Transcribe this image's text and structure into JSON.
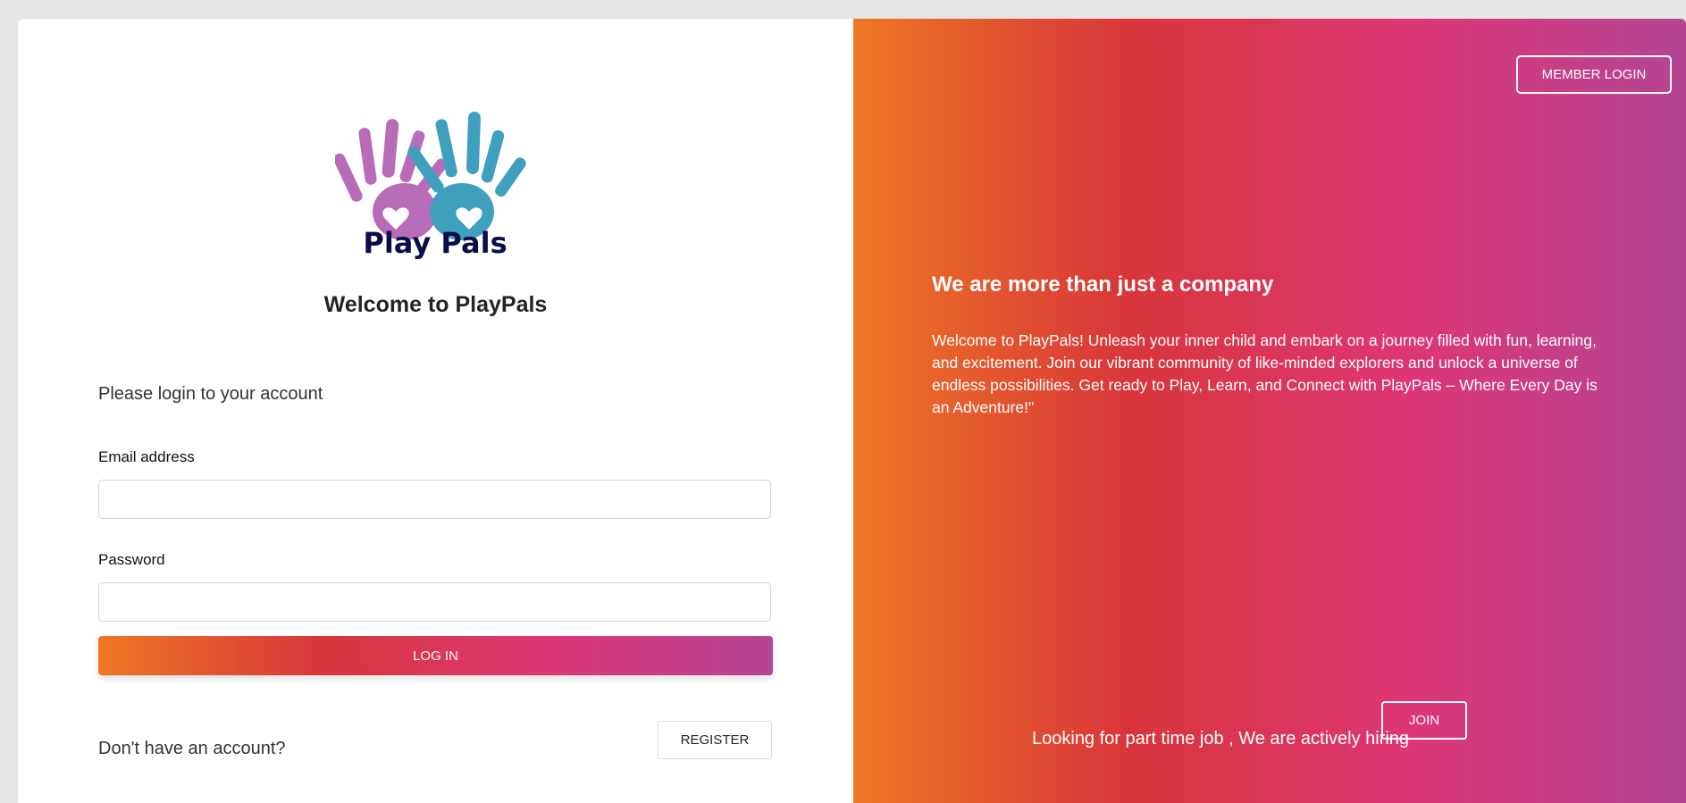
{
  "brand": {
    "logo_text": "Play Pals",
    "logo_colors": [
      "#b86cb8",
      "#3f9fbf",
      "#0b0d4a"
    ]
  },
  "login": {
    "welcome_title": "Welcome to PlayPals",
    "prompt": "Please login to your account",
    "email_label": "Email address",
    "email_value": "",
    "password_label": "Password",
    "password_value": "",
    "login_button": "LOG IN",
    "no_account_text": "Don't have an account?",
    "register_button": "REGISTER"
  },
  "hero": {
    "member_login_button": "MEMBER LOGIN",
    "title": "We are more than just a company",
    "text": "Welcome to PlayPals! Unleash your inner child and embark on a journey filled with fun, learning, and excitement. Join our vibrant community of like-minded explorers and unlock a universe of endless possibilities. Get ready to Play, Learn, and Connect with PlayPals – Where Every Day is an Adventure!\"",
    "hiring_text": "Looking for part time job , We are actively hiring",
    "join_button": "JOIN"
  },
  "colors": {
    "gradient": [
      "#ee7724",
      "#d8363a",
      "#dd3675",
      "#b44593"
    ],
    "page_background": "#e6e6e6"
  }
}
